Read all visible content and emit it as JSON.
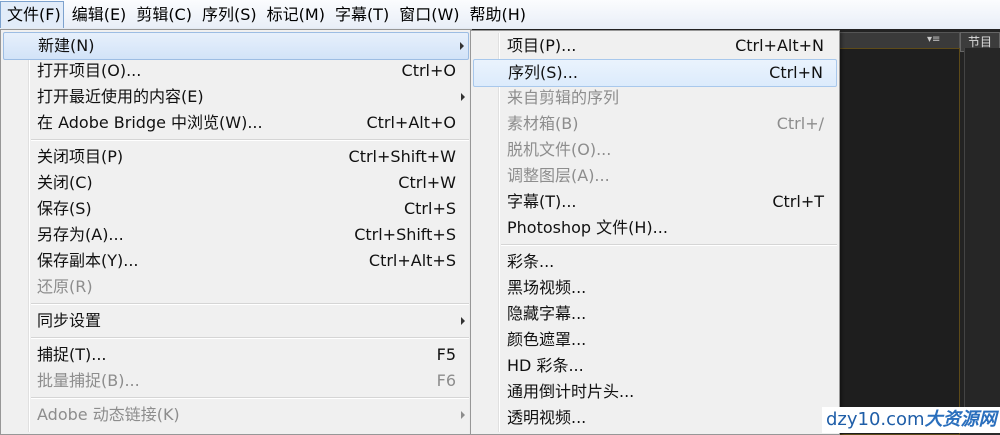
{
  "menubar": {
    "items": [
      {
        "label": "文件(F)",
        "open": true
      },
      {
        "label": "编辑(E)"
      },
      {
        "label": "剪辑(C)"
      },
      {
        "label": "序列(S)"
      },
      {
        "label": "标记(M)"
      },
      {
        "label": "字幕(T)"
      },
      {
        "label": "窗口(W)"
      },
      {
        "label": "帮助(H)"
      }
    ]
  },
  "file_menu": {
    "items": [
      {
        "label": "新建(N)",
        "shortcut": "",
        "submenu": true,
        "disabled": false,
        "highlighted": true
      },
      {
        "label": "打开项目(O)...",
        "shortcut": "Ctrl+O",
        "submenu": false,
        "disabled": false
      },
      {
        "label": "打开最近使用的内容(E)",
        "shortcut": "",
        "submenu": true,
        "disabled": false
      },
      {
        "label": "在 Adobe Bridge 中浏览(W)...",
        "shortcut": "Ctrl+Alt+O",
        "submenu": false,
        "disabled": false
      },
      {
        "separator": true
      },
      {
        "label": "关闭项目(P)",
        "shortcut": "Ctrl+Shift+W",
        "submenu": false,
        "disabled": false
      },
      {
        "label": "关闭(C)",
        "shortcut": "Ctrl+W",
        "submenu": false,
        "disabled": false
      },
      {
        "label": "保存(S)",
        "shortcut": "Ctrl+S",
        "submenu": false,
        "disabled": false
      },
      {
        "label": "另存为(A)...",
        "shortcut": "Ctrl+Shift+S",
        "submenu": false,
        "disabled": false
      },
      {
        "label": "保存副本(Y)...",
        "shortcut": "Ctrl+Alt+S",
        "submenu": false,
        "disabled": false
      },
      {
        "label": "还原(R)",
        "shortcut": "",
        "submenu": false,
        "disabled": true
      },
      {
        "separator": true
      },
      {
        "label": "同步设置",
        "shortcut": "",
        "submenu": true,
        "disabled": false
      },
      {
        "separator": true
      },
      {
        "label": "捕捉(T)...",
        "shortcut": "F5",
        "submenu": false,
        "disabled": false
      },
      {
        "label": "批量捕捉(B)...",
        "shortcut": "F6",
        "submenu": false,
        "disabled": true
      },
      {
        "separator": true
      },
      {
        "label": "Adobe 动态链接(K)",
        "shortcut": "",
        "submenu": true,
        "disabled": true
      }
    ]
  },
  "new_menu": {
    "items": [
      {
        "label": "项目(P)...",
        "shortcut": "Ctrl+Alt+N",
        "disabled": false
      },
      {
        "label": "序列(S)...",
        "shortcut": "Ctrl+N",
        "disabled": false,
        "hovered": true
      },
      {
        "label": "来自剪辑的序列",
        "shortcut": "",
        "disabled": true
      },
      {
        "label": "素材箱(B)",
        "shortcut": "Ctrl+/",
        "disabled": true
      },
      {
        "label": "脱机文件(O)...",
        "shortcut": "",
        "disabled": true
      },
      {
        "label": "调整图层(A)...",
        "shortcut": "",
        "disabled": true
      },
      {
        "label": "字幕(T)...",
        "shortcut": "Ctrl+T",
        "disabled": false
      },
      {
        "label": "Photoshop 文件(H)...",
        "shortcut": "",
        "disabled": false
      },
      {
        "separator": true
      },
      {
        "label": "彩条...",
        "shortcut": "",
        "disabled": false
      },
      {
        "label": "黑场视频...",
        "shortcut": "",
        "disabled": false
      },
      {
        "label": "隐藏字幕...",
        "shortcut": "",
        "disabled": false
      },
      {
        "label": "颜色遮罩...",
        "shortcut": "",
        "disabled": false
      },
      {
        "label": "HD 彩条...",
        "shortcut": "",
        "disabled": false
      },
      {
        "label": "通用倒计时片头...",
        "shortcut": "",
        "disabled": false
      },
      {
        "label": "透明视频...",
        "shortcut": "",
        "disabled": false
      }
    ]
  },
  "panel": {
    "tab_label": "节目",
    "menu_glyph": "▾≡"
  },
  "watermark": {
    "domain": "dzy10.com",
    "cn": "大资源网"
  },
  "colors": {
    "menu_bg": "#f0f0f0",
    "highlight_border": "#a8c8ec",
    "disabled_text": "#8d8d8d",
    "app_bg": "#232323",
    "watermark_text": "#1f5ea8"
  }
}
